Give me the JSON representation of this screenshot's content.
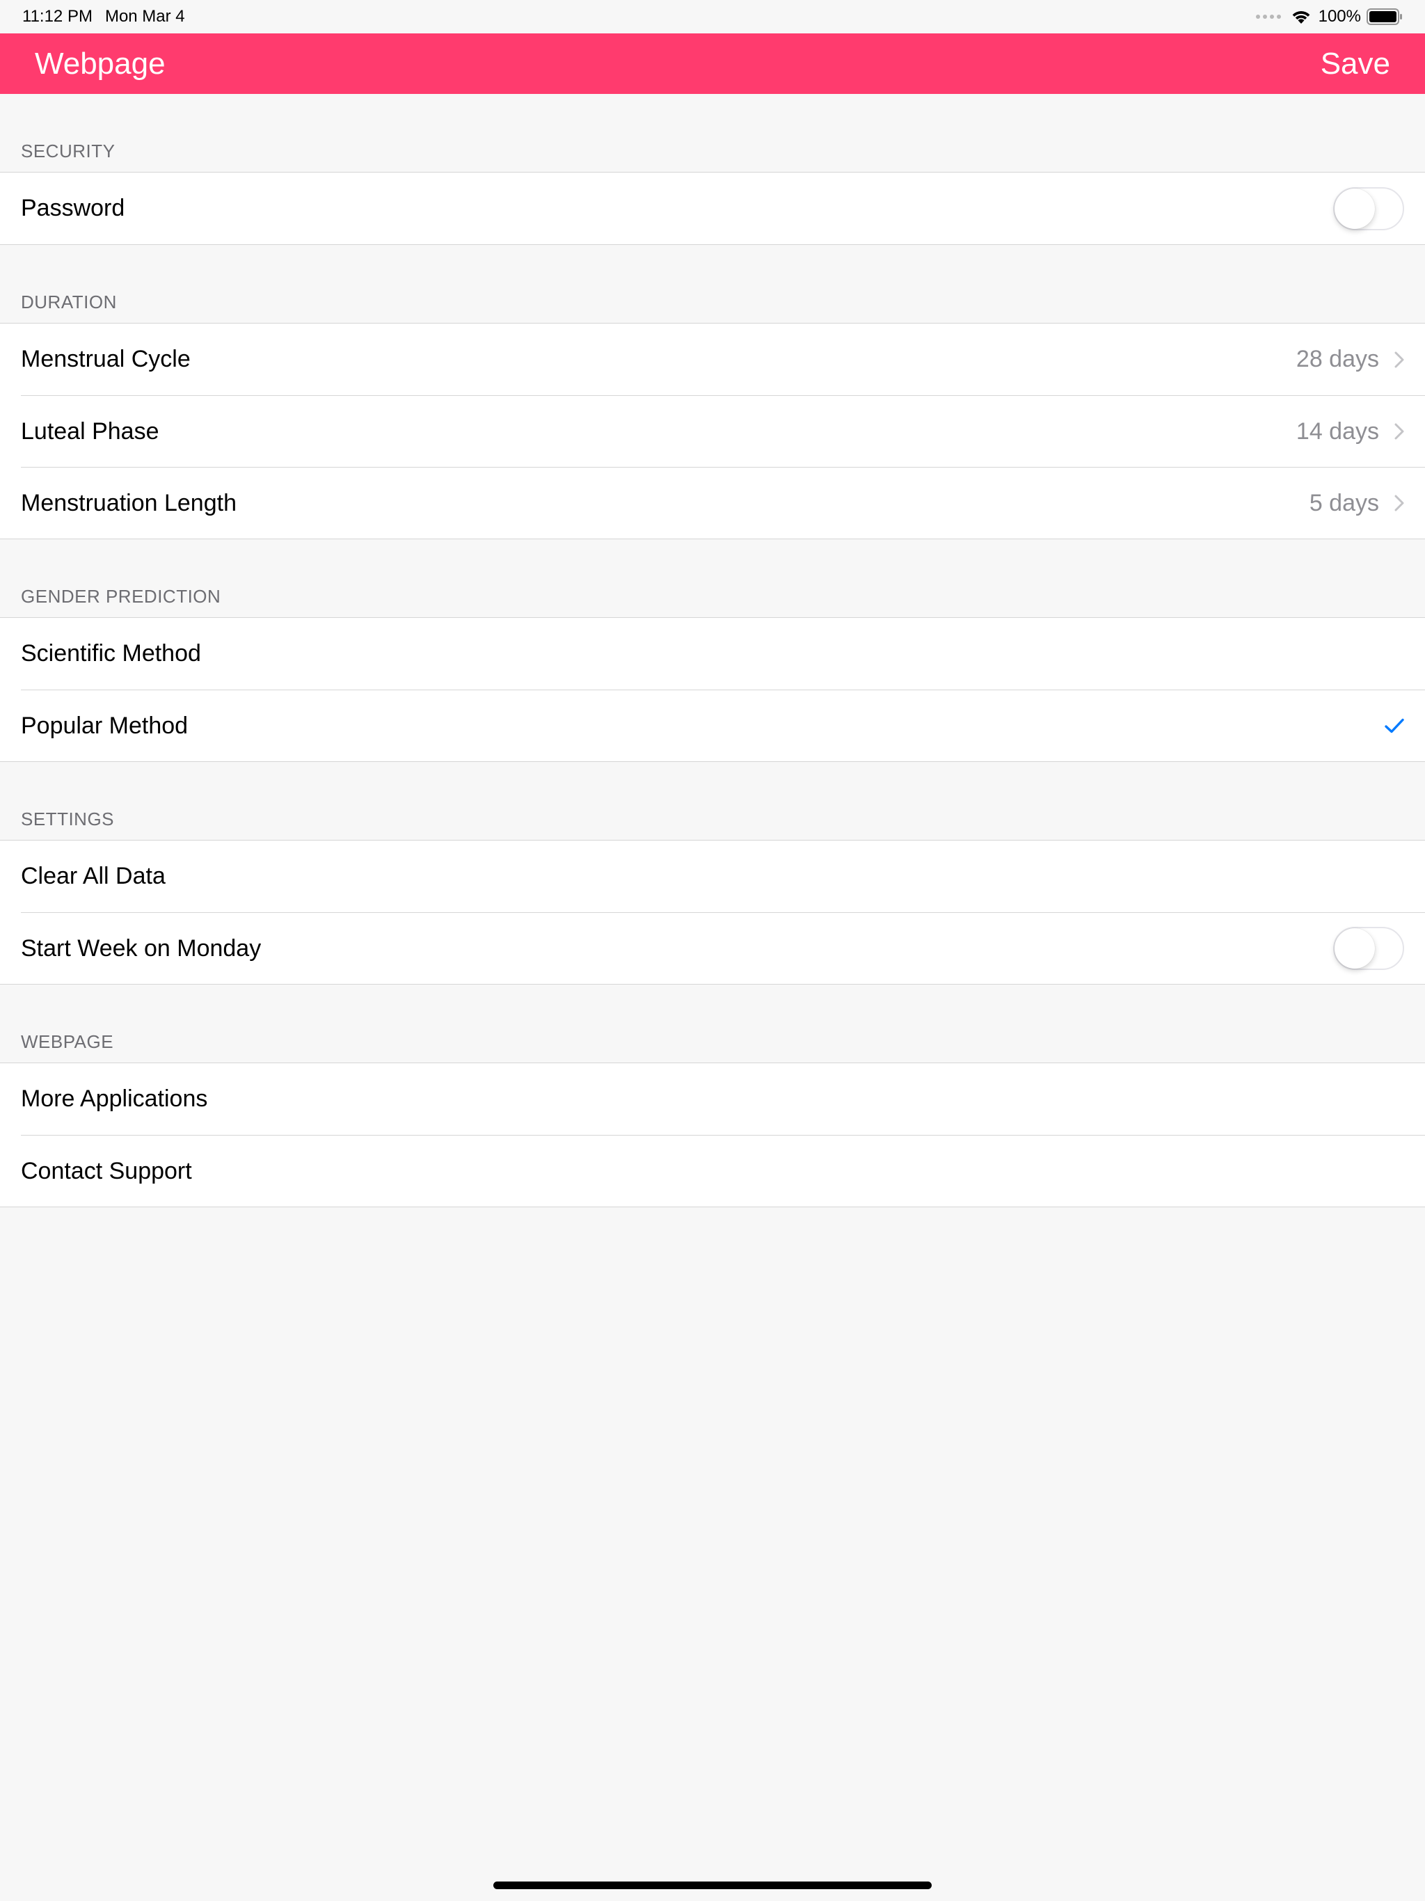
{
  "status_bar": {
    "time": "11:12 PM",
    "date": "Mon Mar 4",
    "battery": "100%"
  },
  "nav": {
    "title": "Webpage",
    "save_label": "Save",
    "accent_color": "#ff3b6e"
  },
  "security": {
    "header": "SECURITY",
    "password": {
      "label": "Password",
      "enabled": false
    }
  },
  "duration": {
    "header": "DURATION",
    "items": [
      {
        "label": "Menstrual Cycle",
        "value": "28 days"
      },
      {
        "label": "Luteal Phase",
        "value": "14 days"
      },
      {
        "label": "Menstruation Length",
        "value": "5 days"
      }
    ]
  },
  "gender_prediction": {
    "header": "GENDER PREDICTION",
    "items": [
      {
        "label": "Scientific Method",
        "selected": false
      },
      {
        "label": "Popular Method",
        "selected": true
      }
    ],
    "check_color": "#007aff"
  },
  "settings": {
    "header": "SETTINGS",
    "clear_all": {
      "label": "Clear All Data"
    },
    "start_week": {
      "label": "Start Week on Monday",
      "enabled": false
    }
  },
  "webpage": {
    "header": "WEBPAGE",
    "items": [
      {
        "label": "More Applications"
      },
      {
        "label": "Contact Support"
      }
    ]
  }
}
